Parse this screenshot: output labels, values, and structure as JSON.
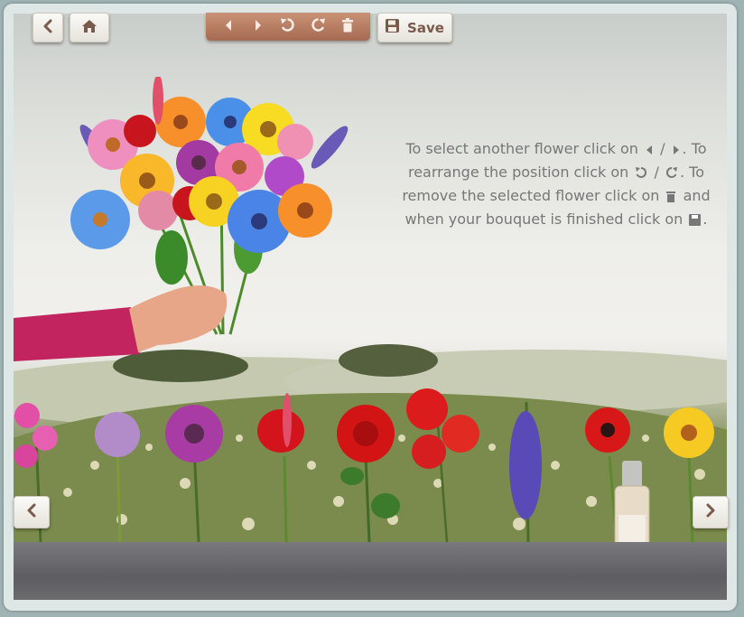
{
  "toolbar": {
    "save_label": "Save",
    "icons": [
      "back-icon",
      "home-icon",
      "previous-icon",
      "next-icon",
      "rotate-left-icon",
      "rotate-right-icon",
      "trash-icon",
      "save-icon"
    ]
  },
  "instructions": {
    "p1": "To select another flower click on",
    "p2": "/",
    "p3": ". To rearrange the position click on",
    "p4": "/",
    "p5": ". To remove the selected flower click on",
    "p6": "and when your bouquet is finished click on",
    "p7": "."
  },
  "colors": {
    "toolbar": "#b77a5f",
    "button_icon": "#7a5b4b",
    "instruction_text": "#777777",
    "sleeve": "#c2245f"
  }
}
